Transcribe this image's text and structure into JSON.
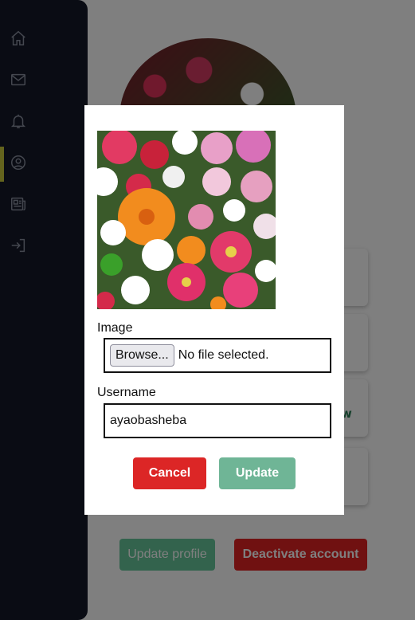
{
  "sidebar": {
    "items": [
      {
        "icon": "home-icon",
        "active": false
      },
      {
        "icon": "mail-icon",
        "active": false
      },
      {
        "icon": "bell-icon",
        "active": false
      },
      {
        "icon": "user-circle-icon",
        "active": true
      },
      {
        "icon": "news-icon",
        "active": false
      },
      {
        "icon": "sign-in-icon",
        "active": false
      }
    ],
    "background": "#141928",
    "active_indicator": "#c8c83c"
  },
  "background_page": {
    "link_text": "w",
    "update_profile_label": "Update profile",
    "deactivate_account_label": "Deactivate account"
  },
  "modal": {
    "image_label": "Image",
    "browse_label": "Browse...",
    "file_status": "No file selected.",
    "username_label": "Username",
    "username_value": "ayaobasheba",
    "cancel_label": "Cancel",
    "update_label": "Update",
    "colors": {
      "cancel": "#dc2626",
      "update": "#6fb596"
    }
  }
}
